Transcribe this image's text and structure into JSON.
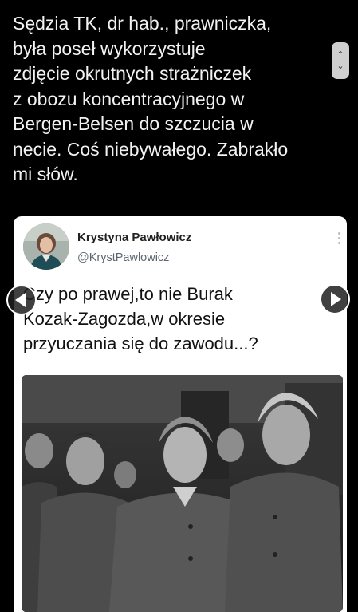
{
  "post": {
    "text": "Sędzia TK, dr hab., prawniczka,\nbyła poseł wykorzystuje\nzdjęcie okrutnych strażniczek\nz obozu koncentracyjnego w\nBergen-Belsen do szczucia w\nnecie. Coś niebywałego. Zabrakło\nmi słów."
  },
  "scrollbar": {
    "up_glyph": "⌃",
    "down_glyph": "⌄"
  },
  "embedded_tweet": {
    "author_name": "Krystyna Pawłowicz",
    "author_handle": "@KrystPawlowicz",
    "text": "Czy po prawej,to nie Burak\nKozak-Zagozda,w okresie\nprzyuczania się do zawodu...?",
    "photo_icon": "black-and-white-photo"
  },
  "navigation": {
    "prev_icon": "arrow-left-icon",
    "next_icon": "arrow-right-icon"
  }
}
